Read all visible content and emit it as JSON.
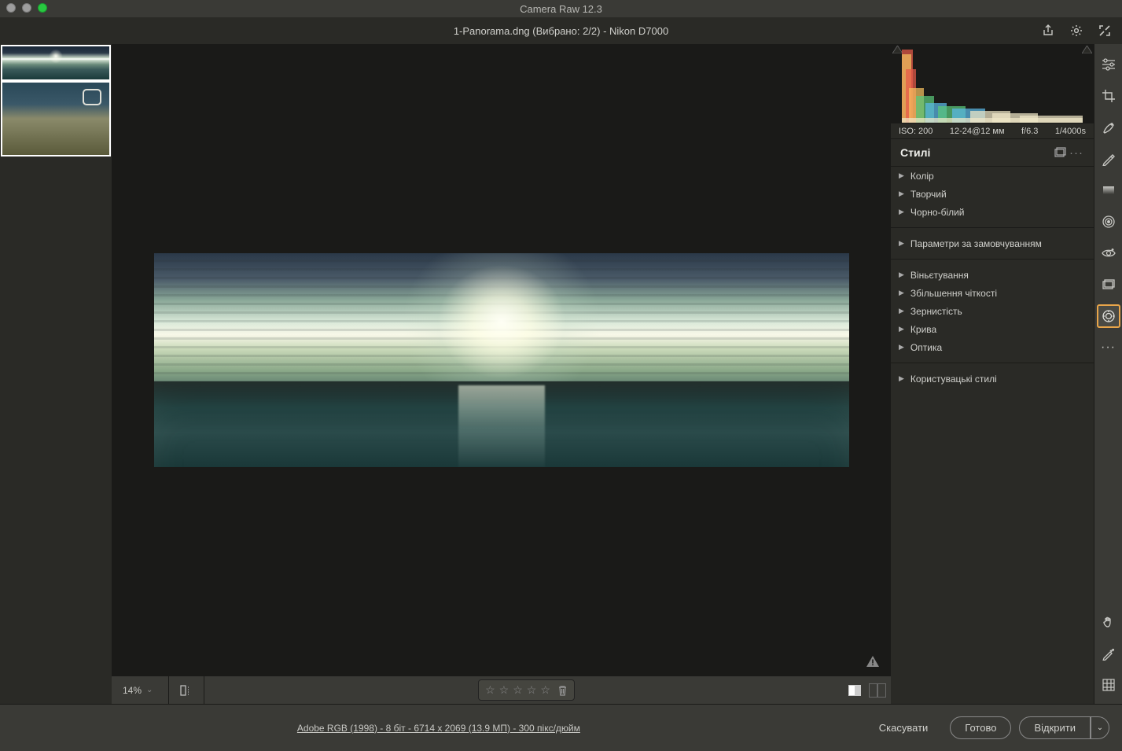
{
  "window": {
    "title": "Camera Raw 12.3"
  },
  "header": {
    "file_label": "1-Panorama.dng (Вибрано: 2/2)  -  Nikon D7000"
  },
  "meta": {
    "iso": "ISO: 200",
    "lens": "12-24@12 мм",
    "aperture": "f/6.3",
    "shutter": "1/4000s"
  },
  "panel": {
    "title": "Стилі",
    "groups": {
      "color": "Колір",
      "creative": "Творчий",
      "bw": "Чорно-білий",
      "defaults": "Параметри за замовчуванням",
      "vignette": "Віньєтування",
      "sharpen": "Збільшення чіткості",
      "grain": "Зернистість",
      "curve": "Крива",
      "optics": "Оптика",
      "user": "Користувацькі стилі"
    }
  },
  "canvas_bar": {
    "zoom": "14%"
  },
  "footer": {
    "workflow_link": "Adobe RGB (1998) - 8 біт - 6714 x 2069 (13.9 МП) - 300 пікс/дюйм",
    "cancel": "Скасувати",
    "done": "Готово",
    "open": "Відкрити"
  },
  "colors": {
    "accent": "#e8a54a"
  }
}
